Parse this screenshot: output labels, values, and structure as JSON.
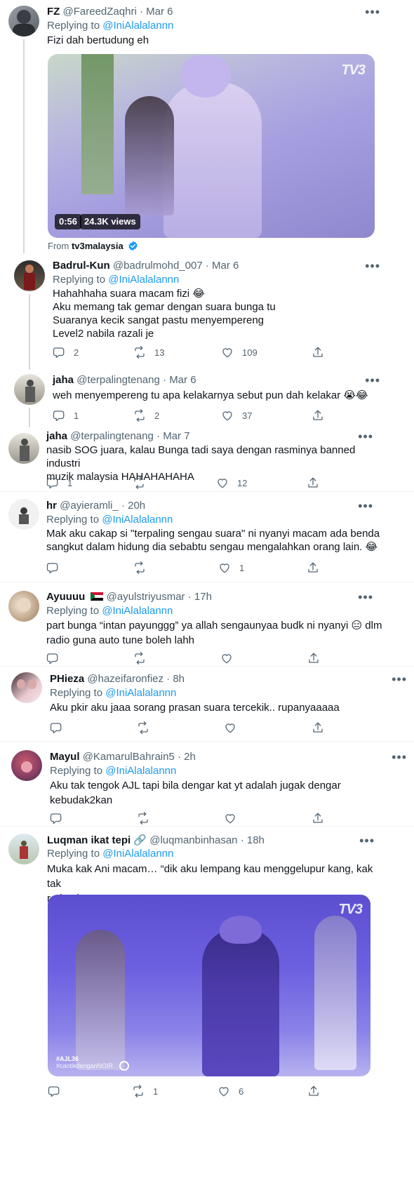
{
  "tweets": [
    {
      "name": "FZ",
      "handle": "@FareedZaqhri",
      "dot": "·",
      "time": "Mar 6",
      "replying_prefix": "Replying to ",
      "mention": "@IniAlalalannn",
      "text": "Fizi dah bertudung eh",
      "video": {
        "duration": "0:56",
        "views": "24.3K views",
        "logo": "TV3"
      },
      "from_prefix": "From ",
      "from_source": "tv3malaysia"
    },
    {
      "name": "Badrul-Kun",
      "handle": "@badrulmohd_007",
      "dot": "·",
      "time": "Mar 6",
      "replying_prefix": "Replying to ",
      "mention": "@IniAlalalannn",
      "text": "Hahahhaha suara macam fizi 😂\nAku memang tak gemar dengan suara bunga tu\nSuaranya kecik sangat pastu menyempereng\nLevel2 nabila razali je",
      "replies": "2",
      "retweets": "13",
      "likes": "109"
    },
    {
      "name": "jaha",
      "handle": "@terpalingtenang",
      "dot": "·",
      "time": "Mar 6",
      "text": "weh menyempereng tu apa kelakarnya sebut pun dah kelakar 😭😂",
      "replies": "1",
      "retweets": "2",
      "likes": "37"
    },
    {
      "name": "jaha",
      "handle": "@terpalingtenang",
      "dot": "·",
      "time": "Mar 7",
      "text": "nasib SOG juara, kalau Bunga tadi saya dengan rasminya banned industri\nmuzik malaysia HAHAHAHAHA",
      "replies": "1",
      "retweets": "",
      "likes": "12"
    },
    {
      "name": "hr",
      "handle": "@ayieramli_",
      "dot": "·",
      "time": "20h",
      "replying_prefix": "Replying to ",
      "mention": "@IniAlalalannn",
      "text": "Mak aku cakap si \"terpaling sengau suara\" ni nyanyi macam ada benda\nsangkut dalam hidung dia sebabtu sengau mengalahkan orang lain. 😂",
      "replies": "",
      "retweets": "",
      "likes": "1"
    },
    {
      "name": "Ayuuuu",
      "handle": "@ayulstriyusmar",
      "dot": "·",
      "time": "17h",
      "replying_prefix": "Replying to ",
      "mention": "@IniAlalalannn",
      "text": "part bunga “intan payunggg” ya allah sengaunyaa budk ni nyanyi 😑 dlm\nradio guna auto tune boleh lahh",
      "replies": "",
      "retweets": "",
      "likes": ""
    },
    {
      "name": "PHieza",
      "handle": "@hazeifaronfiez",
      "dot": "·",
      "time": "8h",
      "replying_prefix": "Replying to ",
      "mention": "@IniAlalalannn",
      "text": "Aku pkir aku jaaa sorang prasan suara tercekik.. rupanyaaaaa",
      "replies": "",
      "retweets": "",
      "likes": ""
    },
    {
      "name": "Mayul",
      "handle": "@KamarulBahrain5",
      "dot": "·",
      "time": "2h",
      "replying_prefix": "Replying to ",
      "mention": "@IniAlalalannn",
      "text": "Aku tak tengok AJL tapi bila dengar kat yt adalah jugak dengar\nkebudak2kan",
      "replies": "",
      "retweets": "",
      "likes": ""
    },
    {
      "name": "Luqman ikat tepi",
      "name_emoji": "🔗",
      "handle": "@luqmanbinhasan",
      "dot": "·",
      "time": "18h",
      "replying_prefix": "Replying to ",
      "mention": "@IniAlalalannn",
      "text": "Muka kak Ani macam… “dik aku lempang kau menggelupur kang, kak tak\nreda ni”",
      "video": {
        "logo": "TV3",
        "tag1": "#AJL36",
        "tag2": "#cantikdenganNOIR"
      },
      "replies": "",
      "retweets": "1",
      "likes": "6"
    }
  ],
  "more_glyph": "•••",
  "colors": {
    "link": "#1d9bf0",
    "muted": "#536471",
    "text": "#0f1419",
    "thread_line": "#cfd9de"
  }
}
